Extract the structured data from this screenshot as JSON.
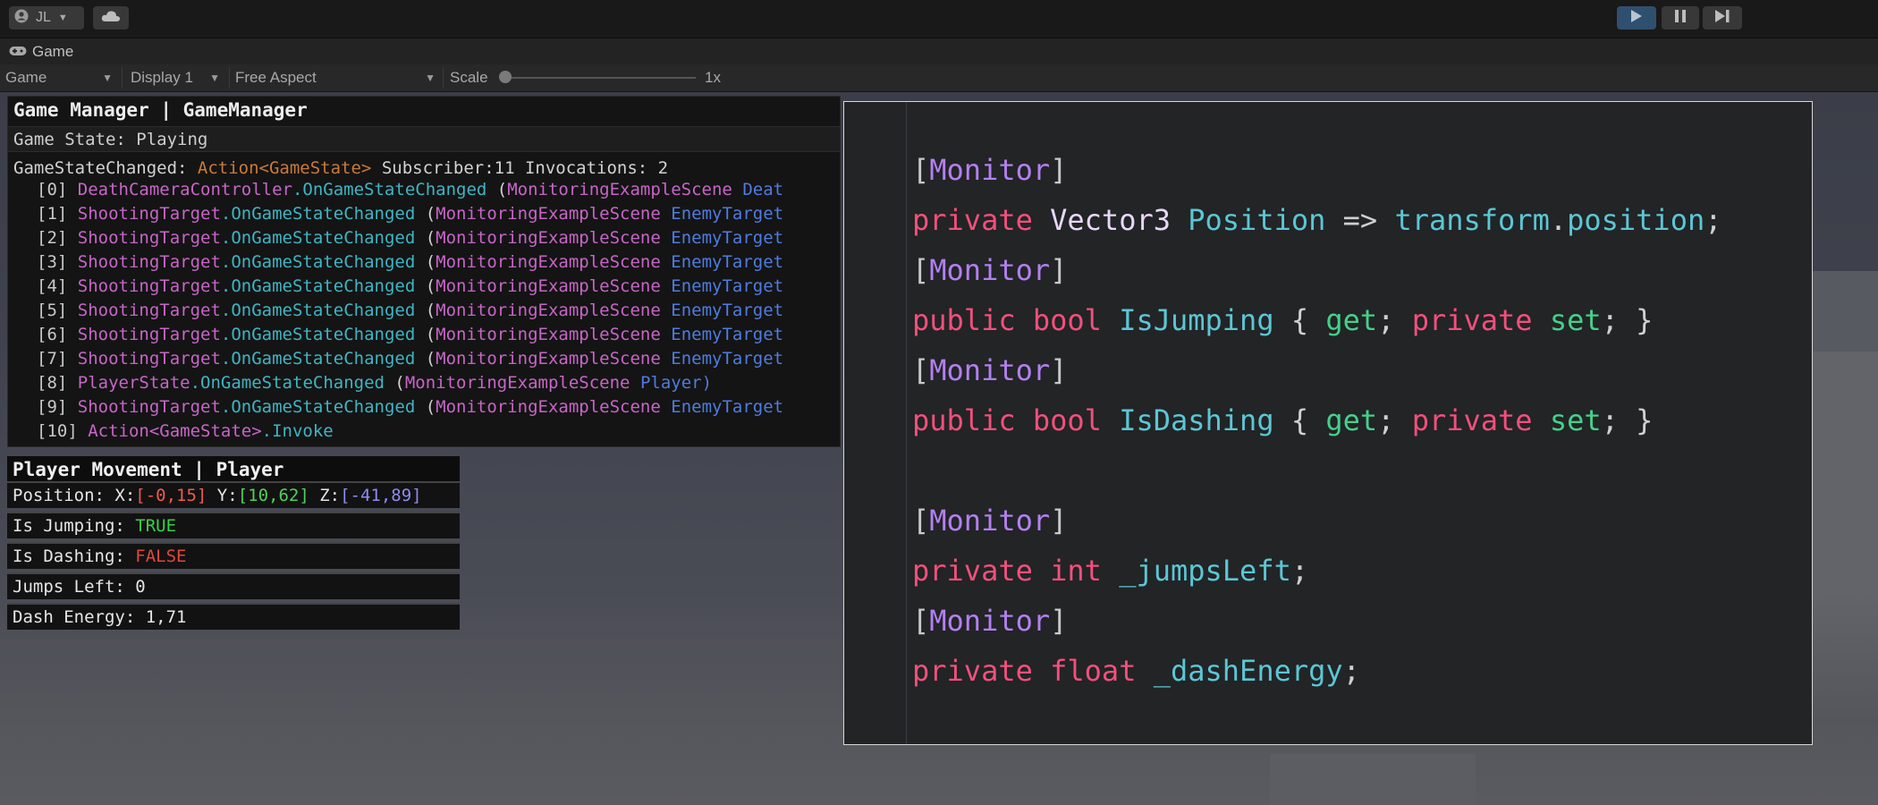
{
  "toolbar": {
    "account_label": "JL",
    "colors": {
      "play_active": "#2f4f6e"
    }
  },
  "game_tab": {
    "label": "Game"
  },
  "game_toolbar": {
    "view_dropdown": "Game",
    "display_dropdown": "Display 1",
    "aspect_dropdown": "Free Aspect",
    "scale_label": "Scale",
    "scale_value": "1x"
  },
  "game_manager": {
    "title": "Game Manager | GameManager",
    "state_line": "Game State: Playing",
    "event": {
      "name": "GameStateChanged: ",
      "type": "Action<GameState>",
      "stats": " Subscriber:11 Invocations: 2"
    },
    "invocations": [
      {
        "index": "[0] ",
        "type": "DeathCameraController",
        "method": ".OnGameStateChanged",
        "paren": " (",
        "scene": "MonitoringExampleScene ",
        "object": "Deat"
      },
      {
        "index": "[1] ",
        "type": "ShootingTarget",
        "method": ".OnGameStateChanged",
        "paren": " (",
        "scene": "MonitoringExampleScene ",
        "object": "EnemyTarget"
      },
      {
        "index": "[2] ",
        "type": "ShootingTarget",
        "method": ".OnGameStateChanged",
        "paren": " (",
        "scene": "MonitoringExampleScene ",
        "object": "EnemyTarget"
      },
      {
        "index": "[3] ",
        "type": "ShootingTarget",
        "method": ".OnGameStateChanged",
        "paren": " (",
        "scene": "MonitoringExampleScene ",
        "object": "EnemyTarget"
      },
      {
        "index": "[4] ",
        "type": "ShootingTarget",
        "method": ".OnGameStateChanged",
        "paren": " (",
        "scene": "MonitoringExampleScene ",
        "object": "EnemyTarget"
      },
      {
        "index": "[5] ",
        "type": "ShootingTarget",
        "method": ".OnGameStateChanged",
        "paren": " (",
        "scene": "MonitoringExampleScene ",
        "object": "EnemyTarget"
      },
      {
        "index": "[6] ",
        "type": "ShootingTarget",
        "method": ".OnGameStateChanged",
        "paren": " (",
        "scene": "MonitoringExampleScene ",
        "object": "EnemyTarget"
      },
      {
        "index": "[7] ",
        "type": "ShootingTarget",
        "method": ".OnGameStateChanged",
        "paren": " (",
        "scene": "MonitoringExampleScene ",
        "object": "EnemyTarget"
      },
      {
        "index": "[8] ",
        "type": "PlayerState",
        "method": ".OnGameStateChanged",
        "paren": " (",
        "scene": "MonitoringExampleScene ",
        "object": "Player)"
      },
      {
        "index": "[9] ",
        "type": "ShootingTarget",
        "method": ".OnGameStateChanged",
        "paren": " (",
        "scene": "MonitoringExampleScene ",
        "object": "EnemyTarget"
      },
      {
        "index": "[10] ",
        "type": "Action<GameState>",
        "method": ".Invoke",
        "paren": "",
        "scene": "",
        "object": ""
      }
    ]
  },
  "player_movement": {
    "title": "Player Movement | Player",
    "position": {
      "label": "Position: X:",
      "x": "[-0,15]",
      "y_label": " Y:",
      "y": "[10,62]",
      "z_label": " Z:",
      "z": "[-41,89]"
    },
    "is_jumping": {
      "label": "Is Jumping: ",
      "value": "TRUE"
    },
    "is_dashing": {
      "label": "Is Dashing: ",
      "value": "FALSE"
    },
    "jumps_left": "Jumps Left: 0",
    "dash_energy": "Dash Energy: 1,71"
  },
  "code": {
    "l1": {
      "b1": "[",
      "attr": "Monitor",
      "b2": "]"
    },
    "l2": {
      "kw": "private ",
      "type": "Vector3 ",
      "id": "Position",
      "op": " => ",
      "obj": "transform",
      "dot": ".",
      "prop": "position",
      "end": ";"
    },
    "l3": {
      "b1": "[",
      "attr": "Monitor",
      "b2": "]"
    },
    "l4": {
      "kw1": "public ",
      "kw2": "bool ",
      "id": "IsJumping",
      "ob": " { ",
      "get": "get",
      "semi1": "; ",
      "kw3": "private ",
      "set": "set",
      "cb": "; }"
    },
    "l5": {
      "b1": "[",
      "attr": "Monitor",
      "b2": "]"
    },
    "l6": {
      "kw1": "public ",
      "kw2": "bool ",
      "id": "IsDashing",
      "ob": " { ",
      "get": "get",
      "semi1": "; ",
      "kw3": "private ",
      "set": "set",
      "cb": "; }"
    },
    "l7": {
      "b1": "[",
      "attr": "Monitor",
      "b2": "]"
    },
    "l8": {
      "kw1": "private ",
      "kw2": "int ",
      "id": "_jumpsLeft",
      "end": ";"
    },
    "l9": {
      "b1": "[",
      "attr": "Monitor",
      "b2": "]"
    },
    "l10": {
      "kw1": "private ",
      "kw2": "float ",
      "id": "_dashEnergy",
      "end": ";"
    }
  }
}
